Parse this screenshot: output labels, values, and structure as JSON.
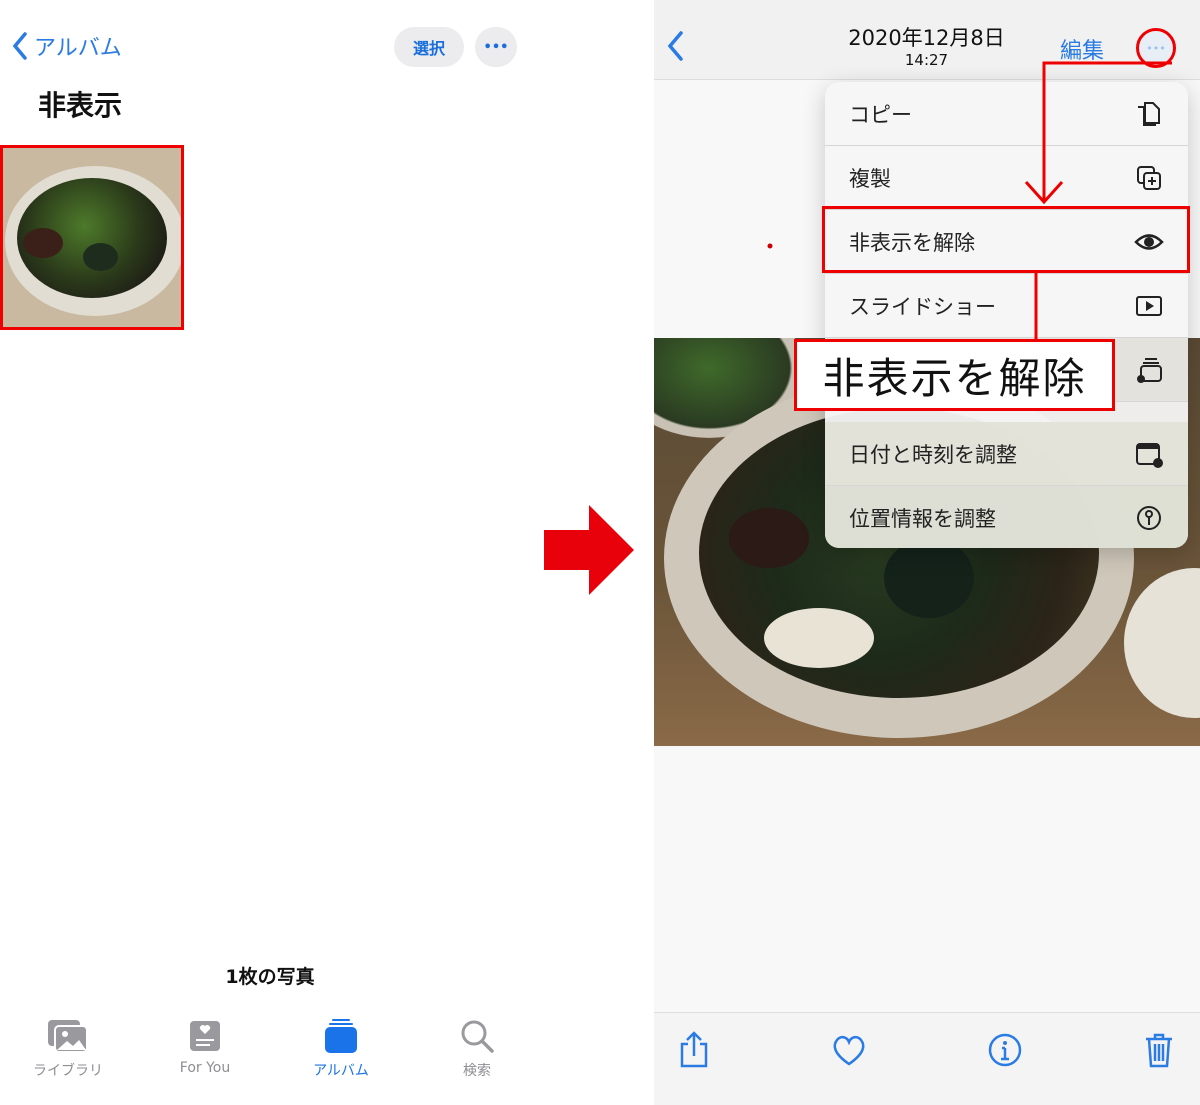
{
  "left": {
    "back_label": "アルバム",
    "select_label": "選択",
    "more_label": "•••",
    "title": "非表示",
    "photo_count": "1枚の写真",
    "tabs": [
      {
        "label": "ライブラリ",
        "icon": "photo-library-icon",
        "active": false
      },
      {
        "label": "For You",
        "icon": "for-you-icon",
        "active": false
      },
      {
        "label": "アルバム",
        "icon": "album-icon",
        "active": true
      },
      {
        "label": "検索",
        "icon": "search-icon",
        "active": false
      }
    ]
  },
  "right": {
    "date": "2020年12月8日",
    "time": "14:27",
    "edit_label": "編集",
    "more_label": "•••",
    "menu": [
      {
        "label": "コピー",
        "icon": "copy-icon"
      },
      {
        "label": "複製",
        "icon": "duplicate-icon"
      },
      {
        "label": "非表示を解除",
        "icon": "eye-icon"
      },
      {
        "label": "スライドショー",
        "icon": "slideshow-icon"
      },
      {
        "label": "",
        "icon": "add-to-album-icon"
      },
      {
        "label": "日付と時刻を調整",
        "icon": "calendar-clock-icon"
      },
      {
        "label": "位置情報を調整",
        "icon": "location-info-icon"
      }
    ],
    "callout": "非表示を解除",
    "toolbar": [
      "share-icon",
      "heart-icon",
      "info-icon",
      "trash-icon"
    ]
  },
  "colors": {
    "accent": "#1a73e8",
    "annotation": "#e00000"
  }
}
